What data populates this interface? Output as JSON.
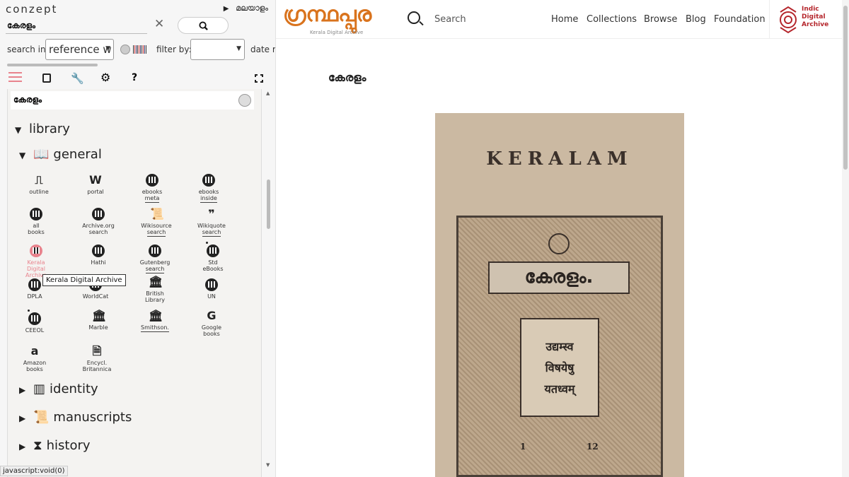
{
  "left": {
    "brand": "conzept",
    "lang": "മലയാളം",
    "query": "കേരളം",
    "search_in_label": "search in:",
    "search_in_value": "reference w",
    "filter_by_label": "filter by:",
    "date_label": "date ra",
    "topic": "കേരളം",
    "sections": {
      "library": "library",
      "general": "general",
      "identity": "identity",
      "manuscripts": "manuscripts",
      "history": "history"
    },
    "items": [
      {
        "l1": "outline"
      },
      {
        "l1": "portal"
      },
      {
        "l1": "ebooks",
        "l2": "meta"
      },
      {
        "l1": "ebooks",
        "l2": "inside"
      },
      {
        "l1": "all",
        "l2": "books"
      },
      {
        "l1": "Archive.org",
        "l2": "search"
      },
      {
        "l1": "Wikisource",
        "l2": "search"
      },
      {
        "l1": "Wikiquote",
        "l2": "search"
      },
      {
        "l1": "Kerala",
        "l2": "Digital",
        "l3": "Archive"
      },
      {
        "l1": "Hathi"
      },
      {
        "l1": "Gutenberg",
        "l2": "search"
      },
      {
        "l1": "Std",
        "l2": "eBooks"
      },
      {
        "l1": "DPLA"
      },
      {
        "l1": "WorldCat"
      },
      {
        "l1": "British",
        "l2": "Library"
      },
      {
        "l1": "UN"
      },
      {
        "l1": "CEEOL"
      },
      {
        "l1": "Marble"
      },
      {
        "l1": "Smithson."
      },
      {
        "l1": "Google",
        "l2": "books"
      },
      {
        "l1": "Amazon",
        "l2": "books"
      },
      {
        "l1": "Encycl.",
        "l2": "Britannica"
      }
    ],
    "tooltip": "Kerala Digital Archive",
    "status": "javascript:void(0)"
  },
  "right": {
    "logo": "ഗ്രന്ഥപ്പുര",
    "logo_sub": "Kerala Digital Archive",
    "search": "Search",
    "nav": [
      "Home",
      "Collections",
      "Browse",
      "Blog",
      "Foundation"
    ],
    "ida": [
      "Indic",
      "Digital",
      "Archive"
    ],
    "title": "കേരളം",
    "cover": {
      "kerala": "KERALAM",
      "banner": "കേരളം.",
      "scroll1": "उद्यम्स्व",
      "scroll2": "विषयेषु",
      "scroll3": "यतध्वम्",
      "vol1": "1",
      "vol2": "12"
    }
  },
  "colors": {
    "accent": "#e8838d",
    "logo": "#d9731d",
    "ida": "#b5262c"
  }
}
